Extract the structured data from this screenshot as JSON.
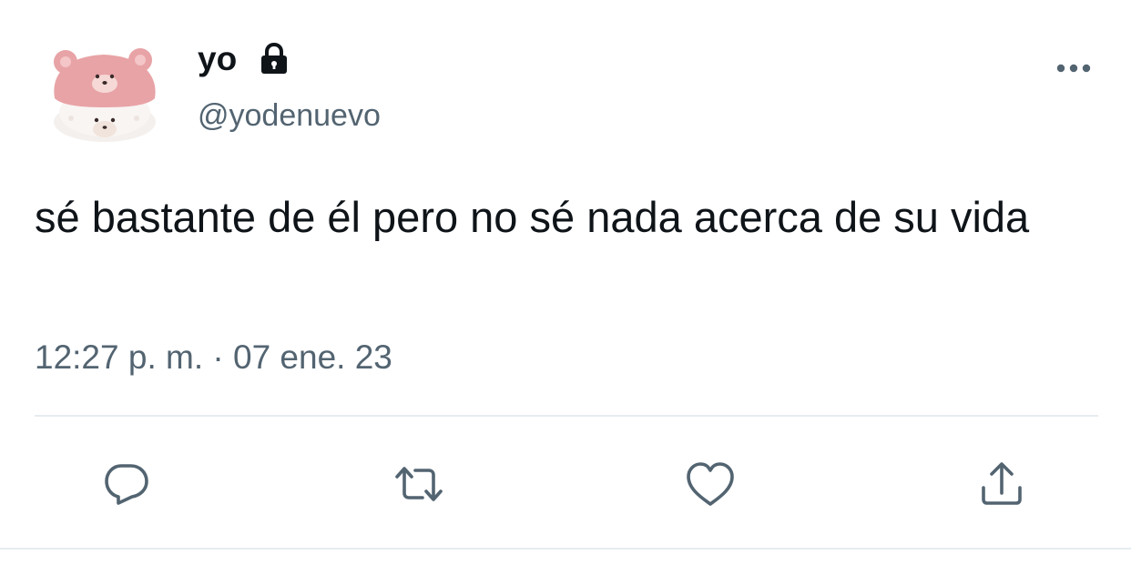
{
  "tweet": {
    "display_name": "yo",
    "handle": "@yodenuevo",
    "text": "sé bastante de él pero no sé nada acerca de su vida",
    "time": "12:27 p. m.",
    "separator": "·",
    "date": "07 ene. 23"
  },
  "icons": {
    "avatar": "pink-bear-hat-plush-avatar",
    "lock": "lock-icon",
    "more": "more-icon",
    "reply": "reply-icon",
    "retweet": "retweet-icon",
    "like": "heart-icon",
    "share": "share-icon"
  },
  "colors": {
    "text": "#0f1419",
    "secondary": "#536471",
    "divider": "#e6ecf0",
    "avatar_pink": "#e8a3a6"
  }
}
